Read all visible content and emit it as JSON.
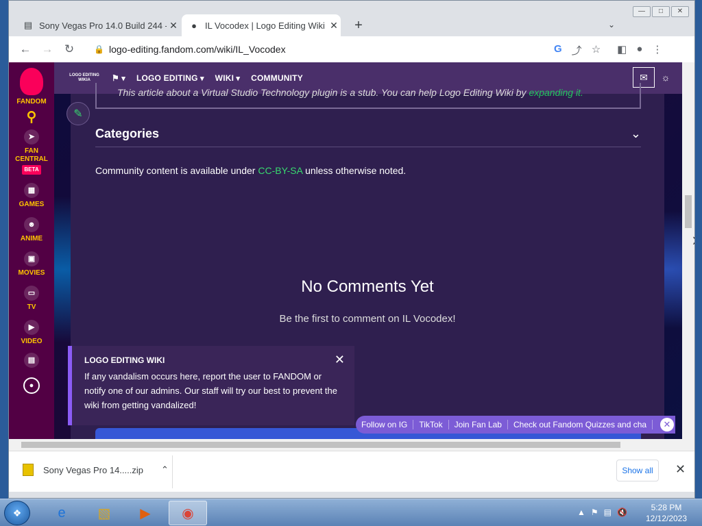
{
  "browser": {
    "tabs": [
      {
        "title": "Sony Vegas Pro 14.0 Build 244 -",
        "favicon": "sony-icon",
        "active": false
      },
      {
        "title": "IL Vocodex | Logo Editing Wiki | F",
        "favicon": "fandom-icon",
        "active": true
      }
    ],
    "new_tab": "+",
    "url": "logo-editing.fandom.com/wiki/IL_Vocodex",
    "back": "←",
    "forward": "→",
    "reload": "↻"
  },
  "fandom_rail": {
    "brand": "FANDOM",
    "items": [
      {
        "label": "FAN CENTRAL",
        "badge": "BETA"
      },
      {
        "label": "GAMES"
      },
      {
        "label": "ANIME"
      },
      {
        "label": "MOVIES"
      },
      {
        "label": "TV"
      },
      {
        "label": "VIDEO"
      }
    ]
  },
  "wikibar": {
    "logo_text": "LOGO EDITING WIKIA",
    "nav": [
      "LOGO EDITING",
      "WIKI",
      "COMMUNITY"
    ]
  },
  "content": {
    "stub_text": "This article about a Virtual Studio Technology plugin is a stub. You can help Logo Editing Wiki by ",
    "stub_link": "expanding it.",
    "categories": "Categories",
    "license_pre": "Community content is available under ",
    "license_link": "CC-BY-SA",
    "license_post": " unless otherwise noted.",
    "no_comments": "No Comments Yet",
    "be_first": "Be the first to comment on IL Vocodex!"
  },
  "notice": {
    "title": "LOGO EDITING WIKI",
    "body": "If any vandalism occurs here, report the user to FANDOM or notify one of our admins. Our staff will try our best to prevent the wiki from getting vandalized!"
  },
  "promo": [
    "Follow on IG",
    "TikTok",
    "Join Fan Lab",
    "Check out Fandom Quizzes and cha"
  ],
  "downloads": {
    "item": "Sony Vegas Pro 14.....zip",
    "show_all": "Show all"
  },
  "clock": {
    "time": "5:28 PM",
    "date": "12/12/2023"
  },
  "colors": {
    "fandom_yellow": "#ffc500",
    "link_green": "#38d96f",
    "wikibar": "#4a2f6a"
  }
}
